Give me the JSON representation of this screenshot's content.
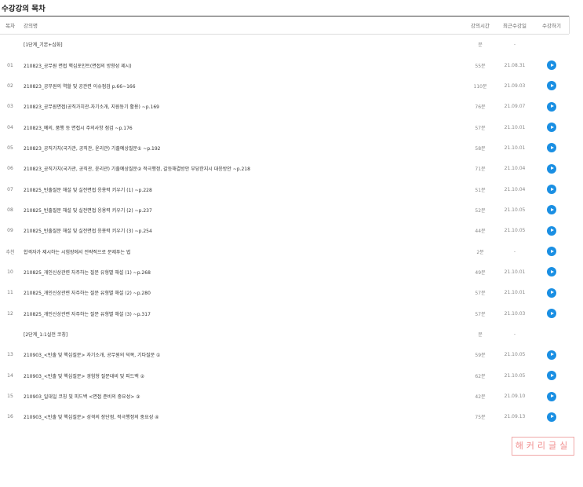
{
  "page": {
    "title": "수강강의 목차"
  },
  "table": {
    "headers": {
      "num": "목차",
      "title": "강의명",
      "time": "강의시간",
      "date": "최근수강일",
      "action": "수강하기"
    },
    "rows": [
      {
        "num": "",
        "title": "[1단계_기본+심화]",
        "time": "분",
        "date": "-",
        "play": false
      },
      {
        "num": "01",
        "title": "210823_공무원 면접 핵심포인트(면접의 방향성 제시)",
        "time": "55분",
        "date": "21.08.31",
        "play": true
      },
      {
        "num": "02",
        "title": "210823_공무원의 역할 및 공관련 이슈점검 p.66~166",
        "time": "110분",
        "date": "21.09.03",
        "play": true
      },
      {
        "num": "03",
        "title": "210823_공무원면접(공직가치관-자기소개, 지원동기 활용) ~p.169",
        "time": "76분",
        "date": "21.09.07",
        "play": true
      },
      {
        "num": "04",
        "title": "210823_예의, 품행 등 면접시 주의사항 점검 ~p.176",
        "time": "57분",
        "date": "21.10.01",
        "play": true
      },
      {
        "num": "05",
        "title": "210823_공직가치(국가관, 공직관, 윤리관) 기출예상질문① ~p.192",
        "time": "58분",
        "date": "21.10.01",
        "play": true
      },
      {
        "num": "06",
        "title": "210823_공직가치(국가관, 공직관, 윤리관) 기출예상질문② 적극행정, 갈등해결방안 부당한지시 대응방안 ~p.218",
        "time": "71분",
        "date": "21.10.04",
        "play": true
      },
      {
        "num": "07",
        "title": "210825_빈출질문 해설 및 실전면접 응용력 키우기 (1) ~p.228",
        "time": "51분",
        "date": "21.10.04",
        "play": true
      },
      {
        "num": "08",
        "title": "210825_빈출질문 해설 및 실전면접 응용력 키우기 (2) ~p.237",
        "time": "52분",
        "date": "21.10.05",
        "play": true
      },
      {
        "num": "09",
        "title": "210825_빈출질문 해설 및 실전면접 응용력 키우기 (3) ~p.254",
        "time": "44분",
        "date": "21.10.05",
        "play": true
      },
      {
        "num": "추천",
        "title": "합격자가 제시하는 시험장에서 전략적으로 문제푸는 법",
        "time": "2분",
        "date": "-",
        "play": true
      },
      {
        "num": "10",
        "title": "210825_개인신상관련 자주하는 질문 유형별 해설 (1) ~p.268",
        "time": "49분",
        "date": "21.10.01",
        "play": true
      },
      {
        "num": "11",
        "title": "210825_개인신상관련 자주하는 질문 유형별 해설 (2) ~p.280",
        "time": "57분",
        "date": "21.10.01",
        "play": true
      },
      {
        "num": "12",
        "title": "210825_개인신상관련 자주하는 질문 유형별 해설 (3) ~p.317",
        "time": "57분",
        "date": "21.10.03",
        "play": true
      },
      {
        "num": "",
        "title": "[2단계_1:1실전 코칭]",
        "time": "분",
        "date": "-",
        "play": false
      },
      {
        "num": "13",
        "title": "210903_<빈출 및 핵심질문> 자기소개, 공무원의 덕목, 기타질문 ①",
        "time": "59분",
        "date": "21.10.05",
        "play": true
      },
      {
        "num": "14",
        "title": "210903_<빈출 및 핵심질문> 경험형 질문대비 및 피드백 ②",
        "time": "62분",
        "date": "21.10.05",
        "play": true
      },
      {
        "num": "15",
        "title": "210903_일대일 코칭 및 피드백 <면접 준비의 중요성> ③",
        "time": "42분",
        "date": "21.09.10",
        "play": true
      },
      {
        "num": "16",
        "title": "210903_<빈출 및 핵심질문> 성격의 장단점, 적극행정의 중요성 ④",
        "time": "75분",
        "date": "21.09.13",
        "play": true
      }
    ]
  },
  "stamp": {
    "text": "해커리글실"
  },
  "colors": {
    "play": "#1a8fe3",
    "stamp": "#f08c8c"
  }
}
